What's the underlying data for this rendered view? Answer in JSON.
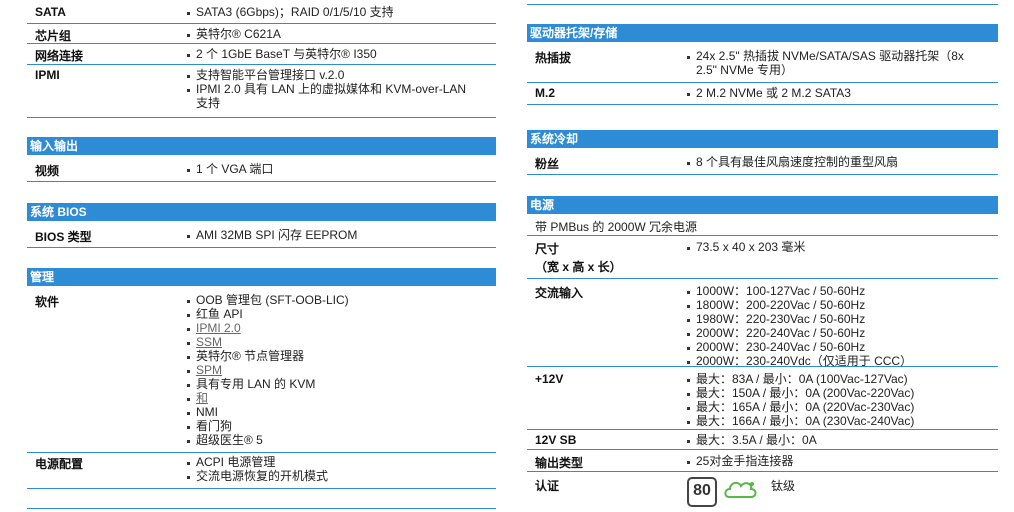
{
  "left": {
    "top_rows": [
      {
        "key": "SATA",
        "values": [
          "SATA3 (6Gbps)；RAID 0/1/5/10 支持"
        ]
      },
      {
        "key": "芯片组",
        "values": [
          "英特尔® C621A"
        ]
      },
      {
        "key": "网络连接",
        "values": [
          "2 个 1GbE BaseT 与英特尔® I350"
        ]
      },
      {
        "key": "IPMI",
        "values": [
          "支持智能平台管理接口 v.2.0",
          "IPMI 2.0 具有 LAN 上的虚拟媒体和 KVM-over-LAN",
          "支持"
        ]
      }
    ],
    "io": {
      "title": "输入输出",
      "rows": [
        {
          "key": "视频",
          "values": [
            "1 个 VGA 端口"
          ]
        }
      ]
    },
    "bios": {
      "title": "系统 BIOS",
      "rows": [
        {
          "key": "BIOS 类型",
          "values": [
            "AMI 32MB SPI 闪存 EEPROM"
          ]
        }
      ]
    },
    "mgmt": {
      "title": "管理",
      "software_key": "软件",
      "software": [
        {
          "text": "OOB 管理包 (SFT-OOB-LIC)",
          "link": false
        },
        {
          "text": "红鱼 API",
          "link": false
        },
        {
          "text": "IPMI 2.0",
          "link": true
        },
        {
          "text": "SSM",
          "link": true
        },
        {
          "text": "英特尔® 节点管理器",
          "link": false
        },
        {
          "text": "SPM",
          "link": true
        },
        {
          "text": "具有专用 LAN 的 KVM",
          "link": false
        },
        {
          "text": "和",
          "link": true
        },
        {
          "text": "NMI",
          "link": false
        },
        {
          "text": "看门狗",
          "link": false
        },
        {
          "text": "超级医生® 5",
          "link": false
        }
      ],
      "power_key": "电源配置",
      "power": [
        "ACPI 电源管理",
        "交流电源恢复的开机模式"
      ]
    }
  },
  "right": {
    "storage": {
      "title": "驱动器托架/存储",
      "rows": [
        {
          "key": "热插拔",
          "values": [
            "24x 2.5\" 热插拔 NVMe/SATA/SAS 驱动器托架（8x 2.5\" NVMe 专用）"
          ]
        },
        {
          "key": "M.2",
          "values": [
            "2 M.2 NVMe 或 2 M.2 SATA3"
          ]
        }
      ]
    },
    "cooling": {
      "title": "系统冷却",
      "rows": [
        {
          "key": "粉丝",
          "values": [
            "8 个具有最佳风扇速度控制的重型风扇"
          ]
        }
      ]
    },
    "power": {
      "title": "电源",
      "note": "带 PMBus 的 2000W 冗余电源",
      "size_key_1": "尺寸",
      "size_key_2": "（宽 x 高 x 长）",
      "size_value": "73.5 x 40 x 203 毫米",
      "ac_key": "交流输入",
      "ac": [
        "1000W：100-127Vac / 50-60Hz",
        "1800W：200-220Vac / 50-60Hz",
        "1980W：220-230Vac / 50-60Hz",
        "2000W：220-240Vac / 50-60Hz",
        "2000W：230-240Vac / 50-60Hz",
        "2000W：230-240Vdc（仅适用于 CCC）"
      ],
      "v12_key": "+12V",
      "v12": [
        "最大：83A / 最小：0A (100Vac-127Vac)",
        "最大：150A / 最小：0A (200Vac-220Vac)",
        "最大：165A / 最小：0A (220Vac-230Vac)",
        "最大：166A / 最小：0A (230Vac-240Vac)"
      ],
      "sb_key": "12V SB",
      "sb": [
        "最大：3.5A / 最小：0A"
      ],
      "out_key": "输出类型",
      "out": [
        "25对金手指连接器"
      ],
      "cert_key": "认证",
      "cert_logo_text": "80",
      "cert_value": "钛级"
    }
  }
}
